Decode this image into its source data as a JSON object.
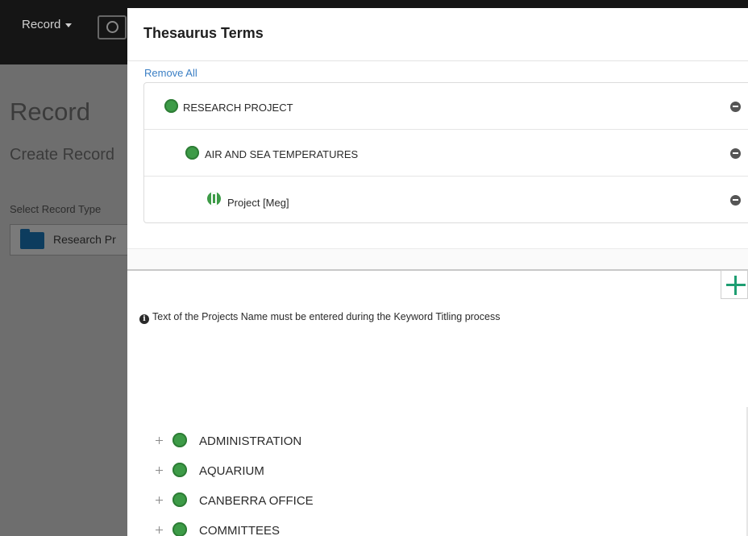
{
  "background": {
    "menu_label": "Record",
    "page_title": "Record",
    "page_subtitle": "Create Record",
    "select_label": "Select Record Type",
    "select_value": "Research Pr"
  },
  "modal": {
    "title": "Thesaurus Terms",
    "remove_all_label": "Remove All",
    "selected_terms": [
      {
        "label": "RESEARCH PROJECT",
        "icon": "green-circle-icon",
        "level": 0
      },
      {
        "label": "AIR AND SEA TEMPERATURES",
        "icon": "green-circle-icon",
        "level": 1
      },
      {
        "label": "Project [Meg]",
        "icon": "project-icon",
        "level": 2
      }
    ],
    "add_button_icon": "plus-icon",
    "info_text": "Text of the Projects Name must be entered during the Keyword Titling process",
    "tree_items": [
      {
        "label": "ADMINISTRATION"
      },
      {
        "label": "AQUARIUM"
      },
      {
        "label": "CANBERRA OFFICE"
      },
      {
        "label": "COMMITTEES"
      }
    ]
  },
  "colors": {
    "accent_green": "#3d9b47",
    "add_green": "#1e9e72",
    "link_blue": "#3b7fc4"
  }
}
